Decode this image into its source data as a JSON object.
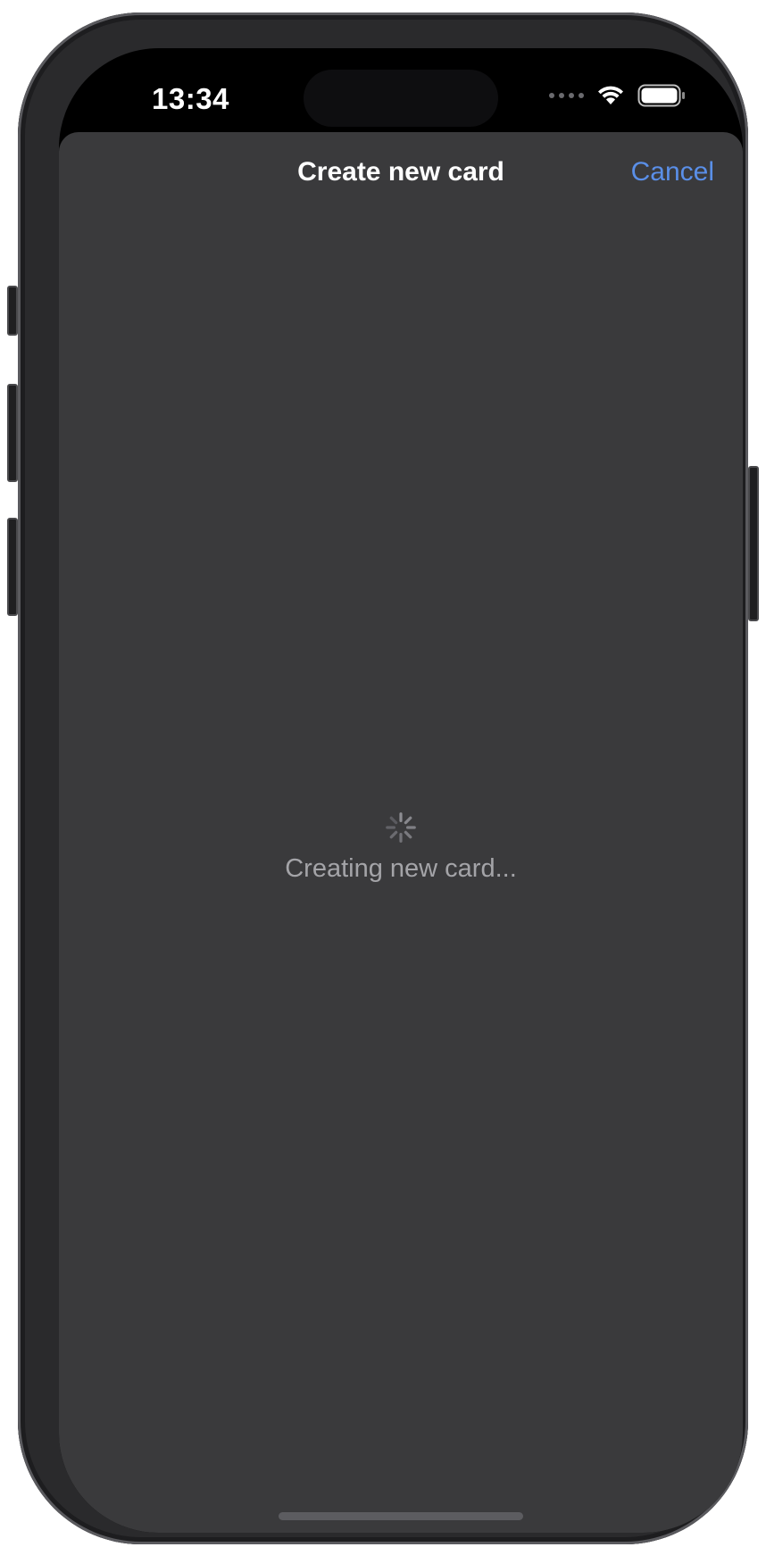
{
  "status_bar": {
    "time": "13:34",
    "icons": [
      "cellular-signal-icon",
      "wifi-icon",
      "battery-icon"
    ]
  },
  "nav": {
    "title": "Create new card",
    "cancel_label": "Cancel"
  },
  "loading": {
    "spinner_icon": "activity-spinner-icon",
    "message": "Creating new card..."
  },
  "colors": {
    "sheet_background": "#3a3a3c",
    "accent": "#5a8fe8",
    "secondary_text": "#a4a4a8"
  }
}
